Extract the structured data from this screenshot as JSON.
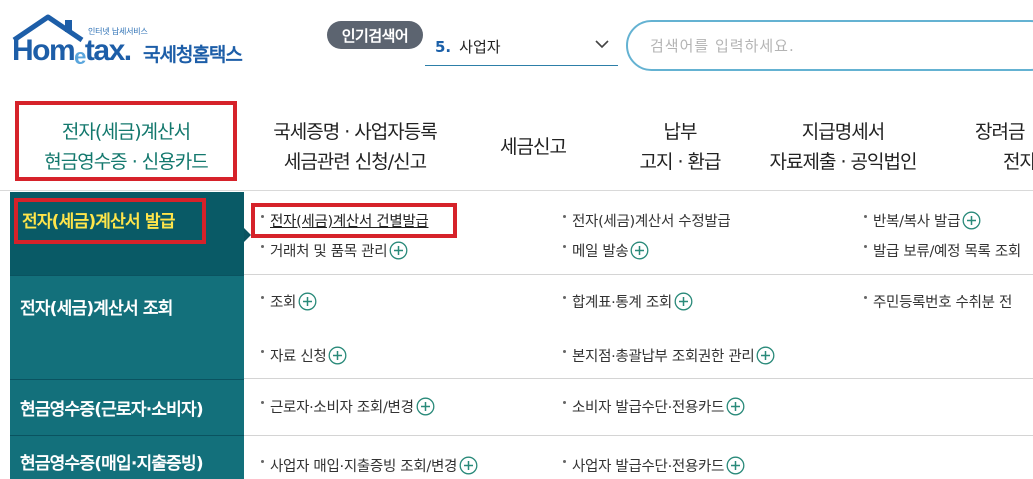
{
  "header": {
    "logo_tagline": "인터넷 납세서비스",
    "logo_word_pre": "Hom",
    "logo_word_e": "e",
    "logo_word_post": "tax.",
    "logo_korean": "국세청홈택스",
    "popular_label": "인기검색어",
    "popular_rank": "5.",
    "popular_term": "사업자",
    "search_placeholder": "검색어를 입력하세요."
  },
  "nav": {
    "items": [
      {
        "line1": "전자(세금)계산서",
        "line2": "현금영수증 · 신용카드",
        "active": true
      },
      {
        "line1": "국세증명 · 사업자등록",
        "line2": "세금관련 신청/신고"
      },
      {
        "line1": "세금신고",
        "line2": ""
      },
      {
        "line1": "납부",
        "line2": "고지 · 환급"
      },
      {
        "line1": "지급명세서",
        "line2": "자료제출 · 공익법인"
      },
      {
        "line1": "장려금",
        "line2": "전자"
      }
    ]
  },
  "submenu": {
    "categories": [
      "전자(세금)계산서 발급",
      "전자(세금)계산서 조회",
      "현금영수증(근로자·소비자)",
      "현금영수증(매입·지출증빙)"
    ],
    "links": {
      "issue_single": "전자(세금)계산서 건별발급",
      "issue_modify": "전자(세금)계산서 수정발급",
      "issue_repeat": "반복/복사 발급",
      "client_items": "거래처 및 품목 관리",
      "mail_send": "메일 발송",
      "issue_hold": "발급 보류/예정 목록 조회",
      "query": "조회",
      "summary_stats": "합계표·통계 조회",
      "resident_no": "주민등록번호 수취분 전",
      "data_request": "자료 신청",
      "branch_auth": "본지점·총괄납부 조회권한 관리",
      "worker_query": "근로자·소비자 조회/변경",
      "consumer_card": "소비자 발급수단·전용카드",
      "biz_purchase": "사업자 매입·지출증빙 조회/변경",
      "biz_card": "사업자 발급수단·전용카드"
    }
  },
  "colors": {
    "brand_blue": "#1d5ea8",
    "teal_dark": "#095a66",
    "teal": "#13707b",
    "highlight_yellow": "#ffe54a",
    "annotation_red": "#d6222a",
    "plus_icon": "#2a8a7a"
  },
  "icons": {
    "plus": "plus-circle-icon",
    "chevron": "chevron-down-icon",
    "house": "house-roof-icon"
  }
}
